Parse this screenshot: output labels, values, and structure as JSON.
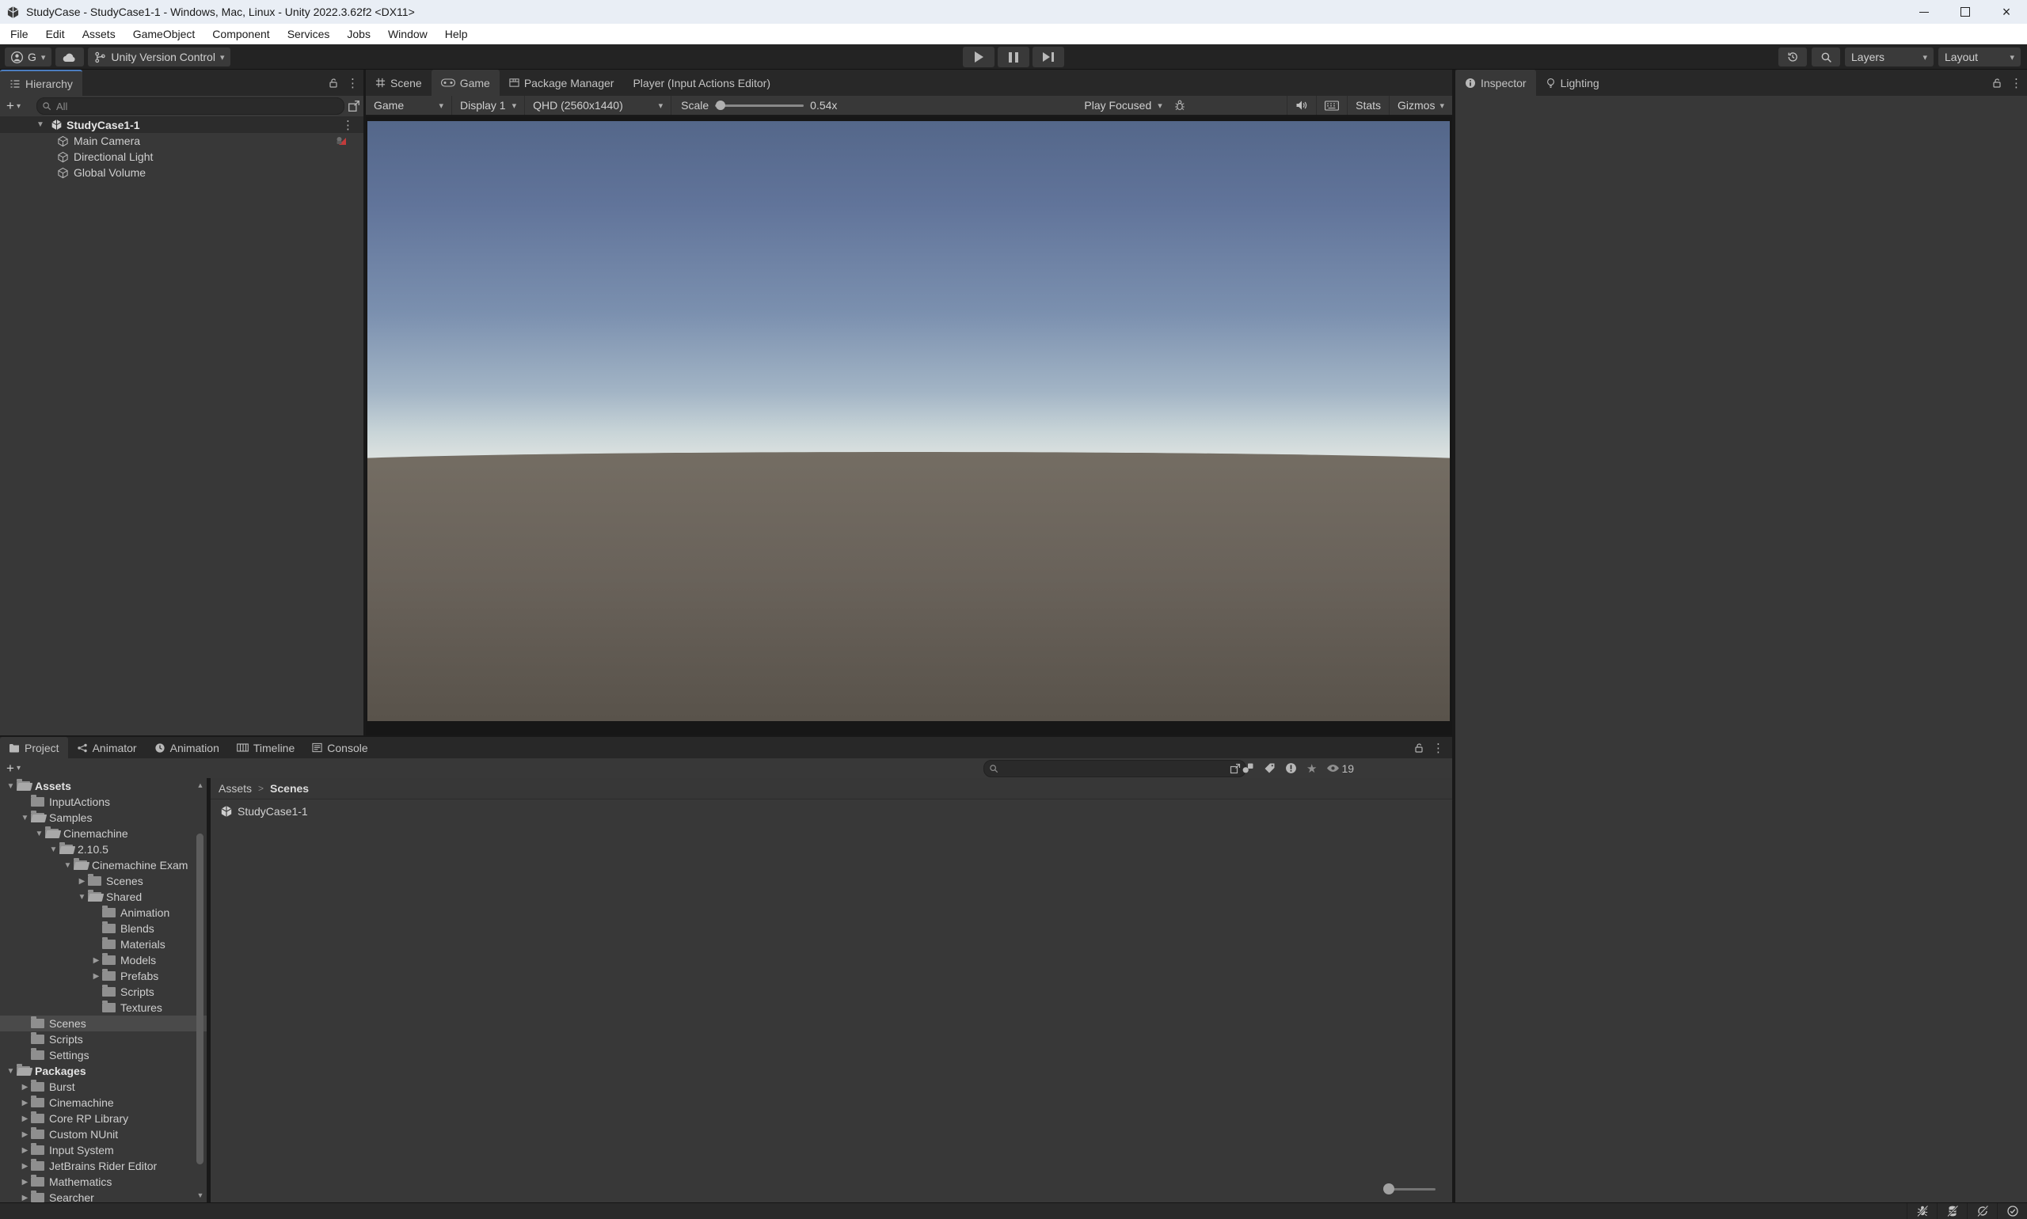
{
  "window": {
    "title": "StudyCase - StudyCase1-1 - Windows, Mac, Linux - Unity 2022.3.62f2 <DX11>"
  },
  "menu_bar": {
    "items": [
      "File",
      "Edit",
      "Assets",
      "GameObject",
      "Component",
      "Services",
      "Jobs",
      "Window",
      "Help"
    ]
  },
  "toolbar": {
    "account_initial": "G",
    "version_control_label": "Unity Version Control",
    "layers_label": "Layers",
    "layout_label": "Layout"
  },
  "hierarchy": {
    "tab_label": "Hierarchy",
    "search_placeholder": "All",
    "scene_name": "StudyCase1-1",
    "items": [
      {
        "label": "Main Camera",
        "gizmo": true
      },
      {
        "label": "Directional Light"
      },
      {
        "label": "Global Volume"
      }
    ]
  },
  "center": {
    "tabs": [
      {
        "label": "Scene",
        "icon": "scene"
      },
      {
        "label": "Game",
        "icon": "game",
        "active": true
      },
      {
        "label": "Package Manager",
        "icon": "package"
      },
      {
        "label": "Player (Input Actions Editor)",
        "icon": "none"
      }
    ],
    "game_toolbar": {
      "target": "Game",
      "display": "Display 1",
      "resolution": "QHD (2560x1440)",
      "scale_label": "Scale",
      "scale_value": "0.54x",
      "play_focused": "Play Focused",
      "stats_label": "Stats",
      "gizmos_label": "Gizmos"
    },
    "game_view": {
      "sky_top": "#54678a",
      "sky_mid": "#7b90af",
      "sky_horizon": "#dae0df",
      "ground_top": "#746d63",
      "ground_bottom": "#58524a"
    }
  },
  "inspector": {
    "tabs": [
      {
        "label": "Inspector",
        "icon": "info",
        "active": true
      },
      {
        "label": "Lighting",
        "icon": "bulb"
      }
    ]
  },
  "bottom_panel": {
    "tabs": [
      {
        "label": "Project",
        "icon": "project",
        "active": true
      },
      {
        "label": "Animator",
        "icon": "animator"
      },
      {
        "label": "Animation",
        "icon": "animation"
      },
      {
        "label": "Timeline",
        "icon": "timeline"
      },
      {
        "label": "Console",
        "icon": "console"
      }
    ]
  },
  "project": {
    "search_placeholder": "",
    "hidden_count": "19",
    "breadcrumb": {
      "root": "Assets",
      "sep": ">",
      "current": "Scenes"
    },
    "content_items": [
      {
        "label": "StudyCase1-1"
      }
    ],
    "tree": [
      {
        "label": "Assets",
        "indent": 0,
        "state": "open",
        "bold": true
      },
      {
        "label": "InputActions",
        "indent": 1,
        "state": "none"
      },
      {
        "label": "Samples",
        "indent": 1,
        "state": "open"
      },
      {
        "label": "Cinemachine",
        "indent": 2,
        "state": "open"
      },
      {
        "label": "2.10.5",
        "indent": 3,
        "state": "open"
      },
      {
        "label": "Cinemachine Exam",
        "indent": 4,
        "state": "open"
      },
      {
        "label": "Scenes",
        "indent": 5,
        "state": "closed"
      },
      {
        "label": "Shared",
        "indent": 5,
        "state": "open"
      },
      {
        "label": "Animation",
        "indent": 6,
        "state": "none"
      },
      {
        "label": "Blends",
        "indent": 6,
        "state": "none"
      },
      {
        "label": "Materials",
        "indent": 6,
        "state": "none"
      },
      {
        "label": "Models",
        "indent": 6,
        "state": "closed"
      },
      {
        "label": "Prefabs",
        "indent": 6,
        "state": "closed"
      },
      {
        "label": "Scripts",
        "indent": 6,
        "state": "none"
      },
      {
        "label": "Textures",
        "indent": 6,
        "state": "none"
      },
      {
        "label": "Scenes",
        "indent": 1,
        "state": "none",
        "selected": true
      },
      {
        "label": "Scripts",
        "indent": 1,
        "state": "none"
      },
      {
        "label": "Settings",
        "indent": 1,
        "state": "none"
      },
      {
        "label": "Packages",
        "indent": 0,
        "state": "open",
        "bold": true
      },
      {
        "label": "Burst",
        "indent": 1,
        "state": "closed"
      },
      {
        "label": "Cinemachine",
        "indent": 1,
        "state": "closed"
      },
      {
        "label": "Core RP Library",
        "indent": 1,
        "state": "closed"
      },
      {
        "label": "Custom NUnit",
        "indent": 1,
        "state": "closed"
      },
      {
        "label": "Input System",
        "indent": 1,
        "state": "closed"
      },
      {
        "label": "JetBrains Rider Editor",
        "indent": 1,
        "state": "closed"
      },
      {
        "label": "Mathematics",
        "indent": 1,
        "state": "closed"
      },
      {
        "label": "Searcher",
        "indent": 1,
        "state": "closed"
      }
    ]
  },
  "status_bar": {
    "icons": [
      "debugger-disabled",
      "cache-server-disabled",
      "auto-refresh-disabled",
      "background-tasks-ok"
    ]
  },
  "icons": {
    "chevron_down": "▾",
    "fold_open": "▼",
    "fold_closed": "▶",
    "kebab": "⋮",
    "plus": "+",
    "scroll_up": "▲",
    "scroll_down": "▼",
    "star": "★",
    "breadcrumb_sep": ">",
    "minimize": "—",
    "close": "×"
  },
  "colors": {
    "accent_focus": "#4c7dbf",
    "panel": "#383838",
    "tabbar": "#282828",
    "toolbar": "#232323"
  }
}
